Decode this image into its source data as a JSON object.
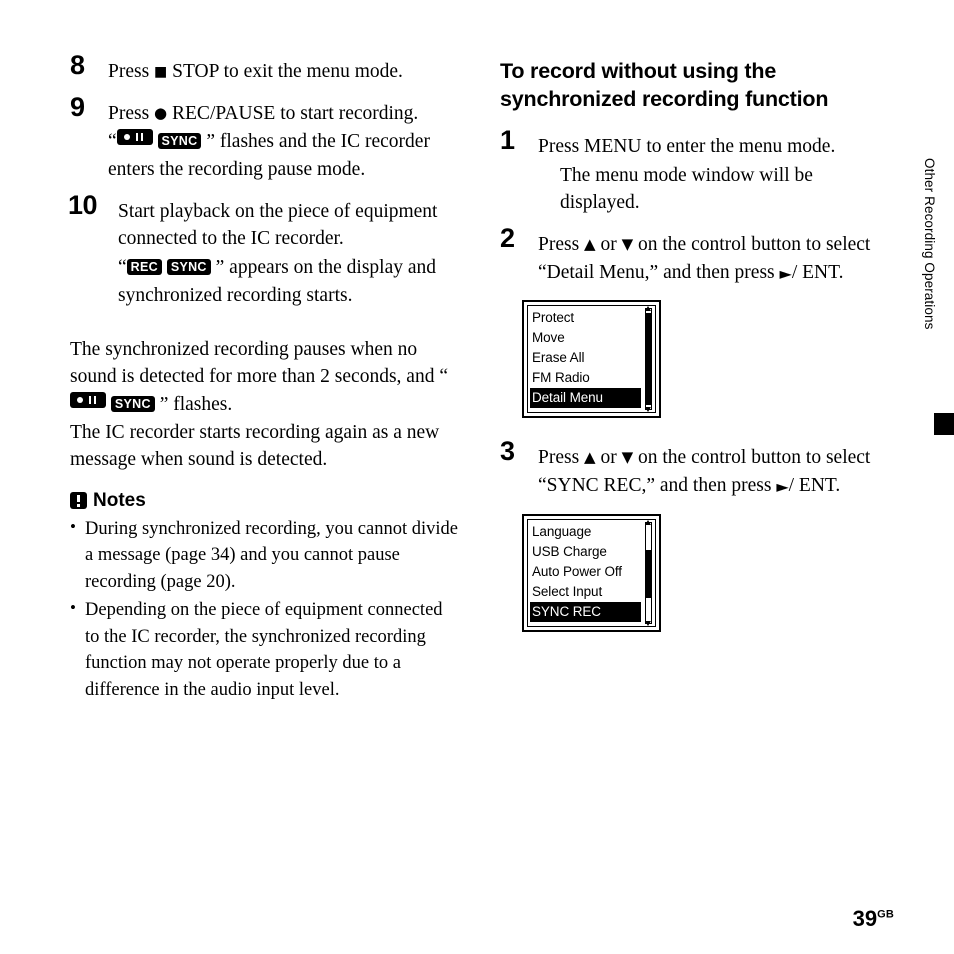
{
  "page": {
    "number": "39",
    "number_suffix": "GB",
    "side_tab_label": "Other Recording Operations"
  },
  "left_column": {
    "steps": [
      {
        "num": "8",
        "text_before": "Press ",
        "symbol": "■",
        "text_after": " STOP to exit the menu mode."
      },
      {
        "num": "9",
        "text_before": "Press ",
        "symbol": "●",
        "text_after": " REC/PAUSE to start recording.",
        "sub_prefix": "“",
        "badge_pause": "rec-pause-icon",
        "badge_sync": "SYNC",
        "sub_suffix": "” flashes and the IC recorder enters the recording pause mode."
      },
      {
        "num": "10",
        "text_after": "Start playback on the piece of equipment connected to the IC recorder.",
        "sub_prefix": "“",
        "badge_rec": "REC",
        "badge_sync": "SYNC",
        "sub_suffix": "” appears on the display and synchronized recording starts."
      }
    ],
    "paragraph_1_a": "The synchronized recording pauses when no sound is detected for more than 2 seconds, and “",
    "paragraph_1_badge_pause": "rec-pause-icon",
    "paragraph_1_badge_sync": "SYNC",
    "paragraph_1_b": "” flashes.",
    "paragraph_2": "The IC recorder starts recording again as a new message when sound is detected.",
    "notes": {
      "heading": "Notes",
      "items": [
        "During synchronized recording, you cannot divide a message (page 34) and you cannot pause recording (page 20).",
        "Depending on the piece of equipment connected to the IC recorder, the synchronized recording function may not operate properly due to a difference in the audio input level."
      ]
    }
  },
  "right_column": {
    "heading": "To record without using the synchronized recording function",
    "steps": [
      {
        "num": "1",
        "text": "Press MENU to enter the menu mode.",
        "sub": "The menu mode window will be displayed."
      },
      {
        "num": "2",
        "part_a": "Press ",
        "up": "▲",
        "or": " or ",
        "down": "▼",
        "part_b": " on the control button to select “Detail Menu,” and then press ",
        "play": "►",
        "part_c": "/ ENT."
      },
      {
        "num": "3",
        "part_a": "Press ",
        "up": "▲",
        "or": " or ",
        "down": "▼",
        "part_b": " on the control button to select “SYNC REC,” and then press ",
        "play": "►",
        "part_c": "/ ENT."
      }
    ],
    "lcd_screens": [
      {
        "items": [
          "Protect",
          "Move",
          "Erase All",
          "FM Radio",
          "Detail Menu"
        ],
        "selected_index": 4,
        "scroll_thumb_top_pct": 2,
        "scroll_thumb_height_pct": 88
      },
      {
        "items": [
          "Language",
          "USB Charge",
          "Auto Power Off",
          "Select Input",
          "SYNC REC"
        ],
        "selected_index": 4,
        "scroll_thumb_top_pct": 27,
        "scroll_thumb_height_pct": 46
      }
    ]
  }
}
